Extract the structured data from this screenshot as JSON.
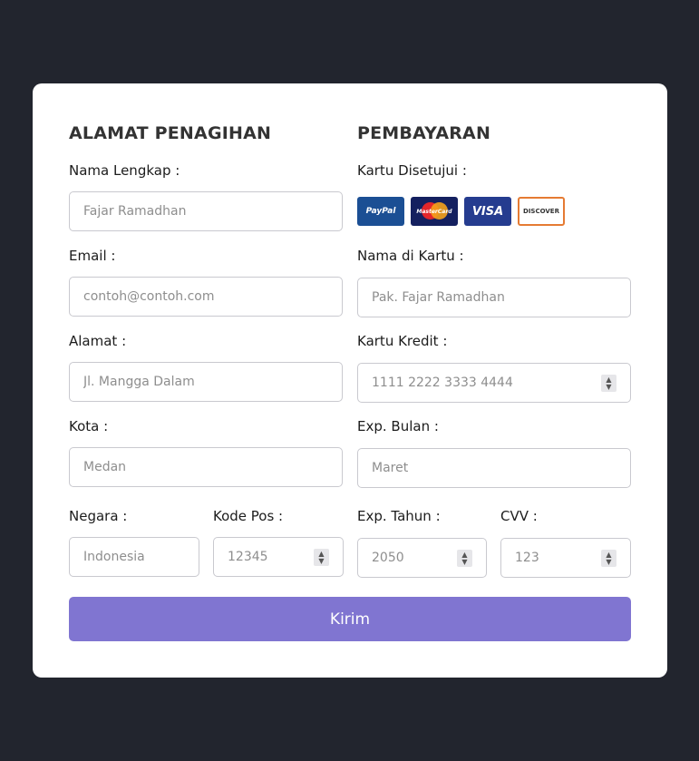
{
  "billing": {
    "title": "ALAMAT PENAGIHAN",
    "full_name": {
      "label": "Nama Lengkap :",
      "placeholder": "Fajar Ramadhan"
    },
    "email": {
      "label": "Email :",
      "placeholder": "contoh@contoh.com"
    },
    "address": {
      "label": "Alamat :",
      "placeholder": "Jl. Mangga Dalam"
    },
    "city": {
      "label": "Kota :",
      "placeholder": "Medan"
    },
    "country": {
      "label": "Negara :",
      "placeholder": "Indonesia"
    },
    "postal": {
      "label": "Kode Pos :",
      "placeholder": "12345"
    }
  },
  "payment": {
    "title": "PEMBAYARAN",
    "accepted_label": "Kartu Disetujui :",
    "accepted_cards": [
      "PayPal",
      "MasterCard",
      "VISA",
      "DISCOVER"
    ],
    "name_on_card": {
      "label": "Nama di Kartu :",
      "placeholder": "Pak. Fajar Ramadhan"
    },
    "credit_card": {
      "label": "Kartu Kredit :",
      "placeholder": "1111 2222 3333 4444"
    },
    "exp_month": {
      "label": "Exp. Bulan :",
      "placeholder": "Maret"
    },
    "exp_year": {
      "label": "Exp. Tahun :",
      "placeholder": "2050"
    },
    "cvv": {
      "label": "CVV :",
      "placeholder": "123"
    }
  },
  "submit_label": "Kirim",
  "colors": {
    "background": "#22252e",
    "card": "#ffffff",
    "accent": "#8075d1"
  }
}
